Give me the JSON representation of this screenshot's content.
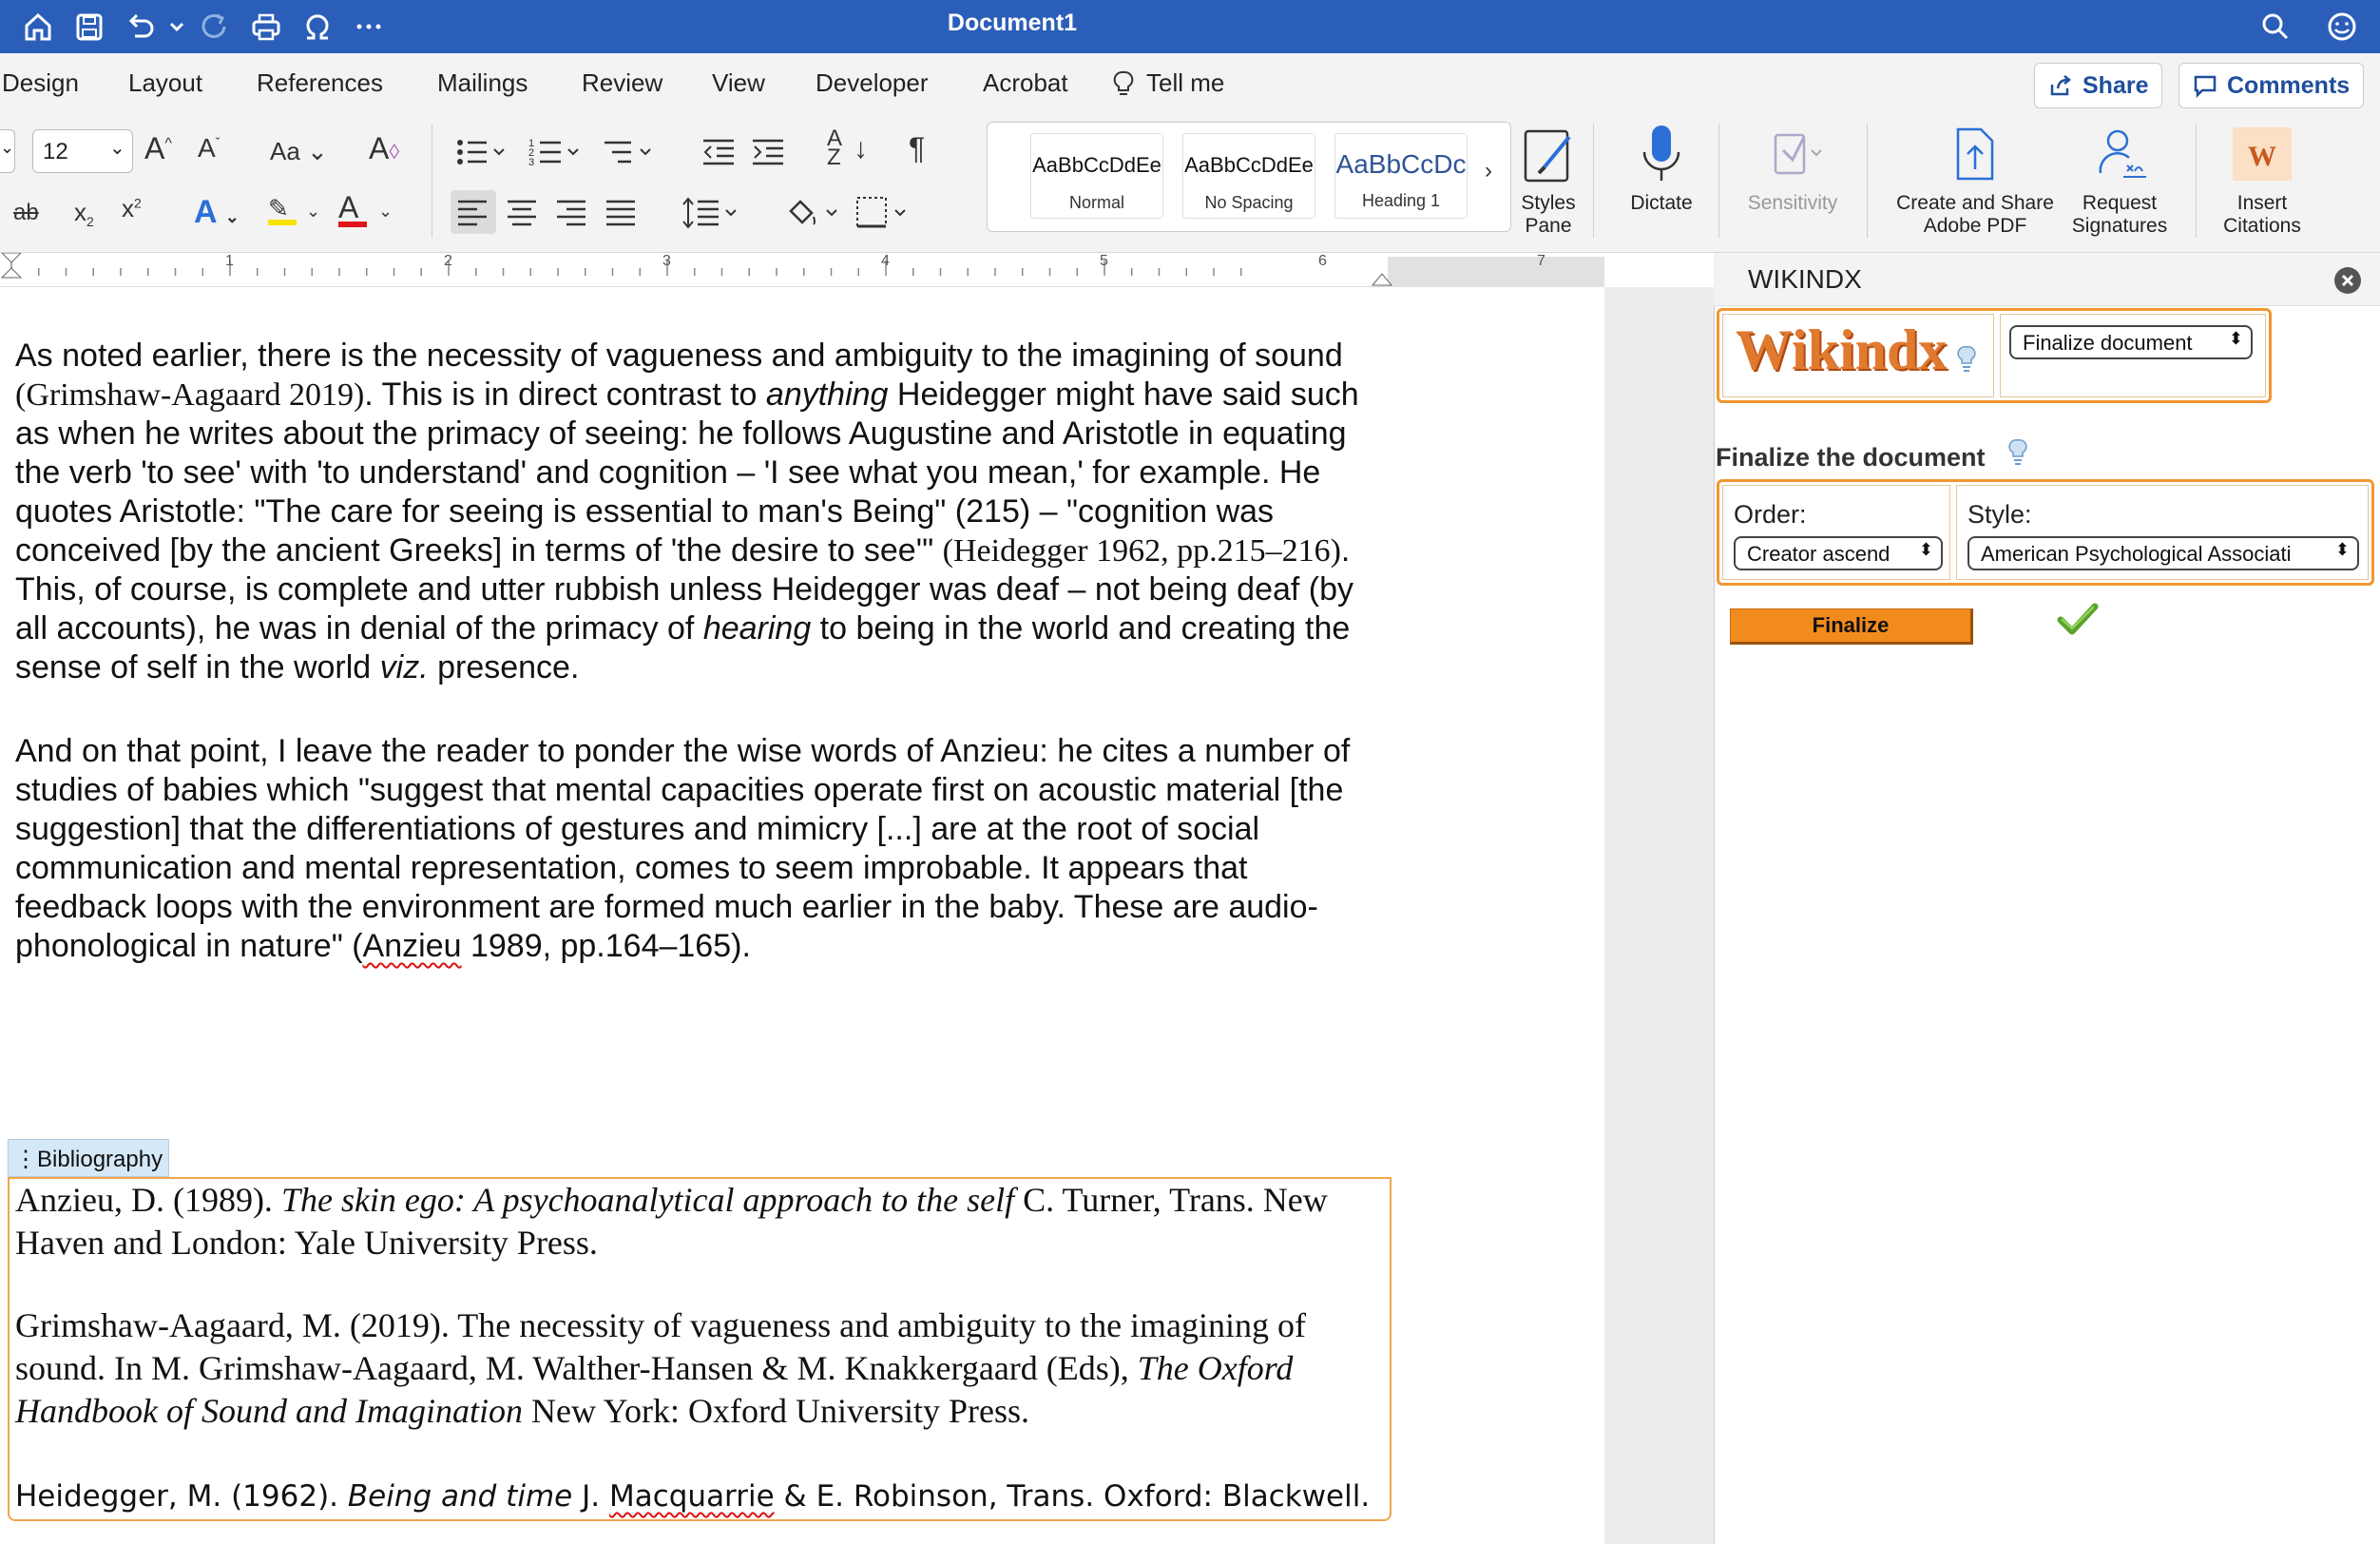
{
  "window": {
    "title": "Document1"
  },
  "tabs": [
    "Design",
    "Layout",
    "References",
    "Mailings",
    "Review",
    "View",
    "Developer",
    "Acrobat",
    "Tell me"
  ],
  "topright": {
    "share": "Share",
    "comments": "Comments"
  },
  "font": {
    "size": "12"
  },
  "ribbon": {
    "styles": [
      {
        "preview": "AaBbCcDdEe",
        "name": "Normal"
      },
      {
        "preview": "AaBbCcDdEe",
        "name": "No Spacing"
      },
      {
        "preview": "AaBbCcDc",
        "name": "Heading 1"
      }
    ],
    "styles_pane": [
      "Styles",
      "Pane"
    ],
    "dictate": "Dictate",
    "sensitivity": "Sensitivity",
    "create_pdf": [
      "Create and Share",
      "Adobe PDF"
    ],
    "request_sig": [
      "Request",
      "Signatures"
    ],
    "insert_cit": [
      "Insert",
      "Citations"
    ]
  },
  "ruler": [
    "1",
    "2",
    "3",
    "4",
    "5",
    "6",
    "7"
  ],
  "body": {
    "p1": {
      "a": "As noted earlier, there is the necessity of vagueness and ambiguity to the imagining of sound ",
      "cite1": "(Grimshaw-Aagaard 2019)",
      "b": ". This is in direct contrast to ",
      "em1": "anything",
      "c": " Heidegger might have said such as when he writes about the primacy of seeing: he follows Augustine and Aristotle in equating the verb 'to see' with 'to understand' and cognition – 'I see what you mean,' for example. He quotes Aristotle: \"The care for seeing is essential to man's Being\" (215) – \"cognition was conceived [by the ancient Greeks] in terms of 'the desire to see'\" ",
      "cite2": "(Heidegger 1962, pp.215–216)",
      "d": ". This, of course, is complete and utter rubbish unless Heidegger was deaf – not being deaf (by all accounts), he was in denial of the primacy of ",
      "em2": "hearing",
      "e": " to being in the world and creating the sense of self in the world ",
      "em3": "viz.",
      "f": " presence."
    },
    "p2": {
      "a": "And on that point, I leave the reader to ponder the wise words of Anzieu: he cites a number of studies of babies which \"suggest that mental capacities operate first on acoustic material [the suggestion] that the differentiations of gestures and mimicry [...] are at the root of social communication and mental representation, comes to seem improbable. It appears that feedback loops with the environment are formed much earlier in the baby. These are audio-phonological in nature\" (",
      "anzieu": "Anzieu",
      "b": " 1989, pp.164–165)."
    }
  },
  "bibliography": {
    "label": "Bibliography",
    "e1": {
      "a": "Anzieu, D. (1989). ",
      "title": "The skin ego: A psychoanalytical approach to the self",
      "b": " C. Turner, Trans. New Haven and London: Yale University Press."
    },
    "e2": {
      "a": "Grimshaw-Aagaard, M. (2019). The necessity of vagueness and ambiguity to the imagining of sound. In M. Grimshaw-Aagaard, M. Walther-Hansen & M. Knakkergaard (Eds), ",
      "title": "The Oxford Handbook of Sound and Imagination",
      "b": " New York: Oxford University Press."
    },
    "e3": {
      "a": "Heidegger, M. (1962). ",
      "title": "Being and time",
      "b": " J. ",
      "mac": "Macquarrie",
      "c": " & E. Robinson, Trans. Oxford: Blackwell."
    }
  },
  "pane": {
    "title": "WIKINDX",
    "logo": "Wikindx",
    "action_select": "Finalize document",
    "heading": "Finalize the document",
    "order_label": "Order:",
    "order_value": "Creator ascend",
    "style_label": "Style:",
    "style_value": "American Psychological Associati",
    "finalize_btn": "Finalize"
  },
  "colors": {
    "titlebar": "#2b5eb8",
    "accent_orange": "#f19632",
    "button_orange": "#f28b1e",
    "check_green": "#6cb33f"
  }
}
